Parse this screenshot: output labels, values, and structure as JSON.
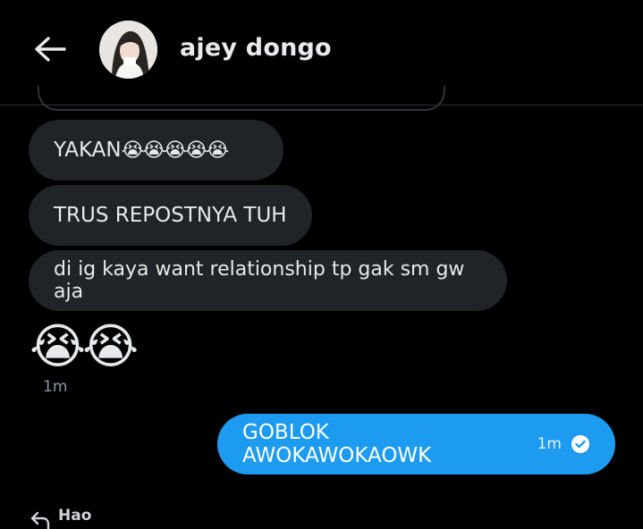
{
  "header": {
    "name": "ajey dongo",
    "back_icon": "arrow-left-icon",
    "avatar_icon": "user-avatar"
  },
  "messages": {
    "m1": {
      "text": "YAKAN",
      "emoji": "😭😭😭😭😭"
    },
    "m2": {
      "text": "TRUS REPOSTNYA TUH"
    },
    "m3": {
      "text": "di ig kaya want relationship tp gak sm gw aja"
    },
    "m4": {
      "emoji": "😭😭",
      "time": "1m"
    },
    "m5": {
      "text": "GOBLOK AWOKAWOKAOWK",
      "time": "1m",
      "status_icon": "check-circle-icon"
    }
  },
  "reply": {
    "icon": "reply-arrow-icon",
    "name": "Hao"
  },
  "colors": {
    "background": "#000000",
    "incoming_bubble": "#202327",
    "outgoing_bubble": "#1d9bf0",
    "text": "#e7e9ea",
    "muted": "#8b98a5"
  }
}
